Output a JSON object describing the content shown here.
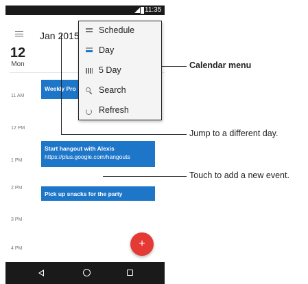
{
  "status_bar": {
    "time": "11:35"
  },
  "app_bar": {
    "title": "Jan 2015",
    "menu_icon": "hamburger-icon"
  },
  "date": {
    "day_number": "12",
    "weekday": "Mon"
  },
  "hours": [
    "11 AM",
    "12 PM",
    "1 PM",
    "2 PM",
    "3 PM",
    "4 PM"
  ],
  "events": [
    {
      "title": "Weekly Pro",
      "subtitle": ""
    },
    {
      "title": "Start hangout with Alexis",
      "subtitle": "https://plus.google.com/hangouts"
    },
    {
      "title": "Pick up snacks for the party",
      "subtitle": ""
    }
  ],
  "fab": {
    "label": "+"
  },
  "menu": {
    "items": [
      {
        "label": "Schedule",
        "icon": "schedule-icon"
      },
      {
        "label": "Day",
        "icon": "day-icon"
      },
      {
        "label": "5 Day",
        "icon": "five-day-icon"
      },
      {
        "label": "Search",
        "icon": "search-icon"
      },
      {
        "label": "Refresh",
        "icon": "refresh-icon"
      }
    ]
  },
  "callouts": {
    "menu": "Calendar menu",
    "jump": "Jump to a different day.",
    "add": "Touch to add a new event."
  },
  "colors": {
    "event_blue": "#1e76c9",
    "fab_red": "#e53935",
    "bar_dark": "#1a1a1a"
  }
}
